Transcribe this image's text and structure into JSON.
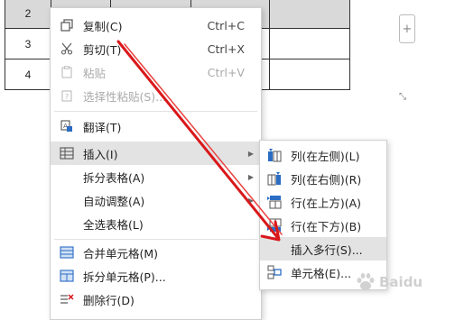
{
  "table": {
    "rows": [
      {
        "num": "2",
        "selected": true
      },
      {
        "num": "3",
        "selected": false
      },
      {
        "num": "4",
        "selected": false
      }
    ],
    "add_column": "+"
  },
  "context_menu": {
    "items": [
      {
        "label": "复制(C)",
        "shortcut": "Ctrl+C",
        "icon": "copy-icon"
      },
      {
        "label": "剪切(T)",
        "shortcut": "Ctrl+X",
        "icon": "scissors-icon"
      },
      {
        "label": "粘贴",
        "shortcut": "Ctrl+V",
        "icon": "paste-icon",
        "disabled": true
      },
      {
        "label": "选择性粘贴(S)...",
        "icon": "paste-special-icon",
        "disabled": true
      },
      {
        "label": "翻译(T)",
        "icon": "translate-icon"
      },
      {
        "label": "插入(I)",
        "icon": "table-insert-icon",
        "submenu": true,
        "highlighted": true
      },
      {
        "label": "拆分表格(A)",
        "submenu": true
      },
      {
        "label": "自动调整(A)",
        "submenu": true
      },
      {
        "label": "全选表格(L)"
      },
      {
        "label": "合并单元格(M)",
        "icon": "merge-cells-icon"
      },
      {
        "label": "拆分单元格(P)...",
        "icon": "split-cells-icon"
      },
      {
        "label": "删除行(D)",
        "icon": "delete-row-icon"
      }
    ]
  },
  "insert_submenu": {
    "items": [
      {
        "label": "列(在左侧)(L)",
        "icon": "insert-col-left-icon"
      },
      {
        "label": "列(在右侧)(R)",
        "icon": "insert-col-right-icon"
      },
      {
        "label": "行(在上方)(A)",
        "icon": "insert-row-above-icon"
      },
      {
        "label": "行(在下方)(B)",
        "icon": "insert-row-below-icon"
      },
      {
        "label": "插入多行(S)...",
        "highlighted": true
      },
      {
        "label": "单元格(E)...",
        "icon": "insert-cell-icon"
      }
    ]
  },
  "colors": {
    "annotation_arrow": "#d9181b",
    "highlight": "#e3e3e3"
  },
  "watermark": {
    "text": "Baidu",
    "icon": "paw-icon"
  }
}
